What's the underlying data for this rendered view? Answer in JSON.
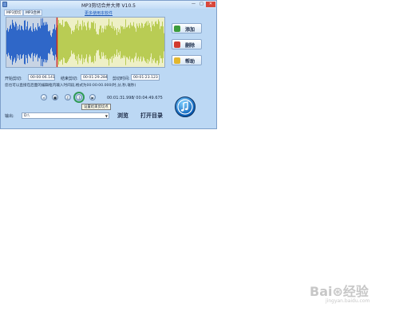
{
  "window": {
    "title": "MP3剪切合并大师 V10.5",
    "minimize": "—",
    "maximize": "□",
    "close": "✕"
  },
  "tabs": [
    {
      "label": "MP3剪切",
      "active": true
    },
    {
      "label": "MP3合并",
      "active": false
    }
  ],
  "promo_link": "更多使用本软件",
  "side_buttons": [
    {
      "label": "添加",
      "icon": "add-icon",
      "color": "#3c9b3a"
    },
    {
      "label": "删除",
      "icon": "delete-icon",
      "color": "#d23b2f"
    },
    {
      "label": "帮助",
      "icon": "help-icon",
      "color": "#e2b62d"
    }
  ],
  "times": {
    "start_label": "开始剪切:",
    "start_value": "00:00:06.141",
    "end_label": "结束剪切:",
    "end_value": "00:01:29.284",
    "length_label": "剪切时间:",
    "length_value": "00:01:23.123"
  },
  "hint": "您也可以直接在后面的编辑框内输入时间段,格式为00:00:00.000(时,分,秒,毫秒)",
  "transport": {
    "buttons": [
      {
        "name": "rewind-button",
        "glyph": "«"
      },
      {
        "name": "stop-button",
        "glyph": "■"
      },
      {
        "name": "set-start-button",
        "glyph": "["
      },
      {
        "name": "set-end-button",
        "glyph": "]"
      },
      {
        "name": "play-button",
        "glyph": "▶"
      }
    ],
    "position": "00:01:31.998",
    "total": "/ 00:04:49.675",
    "tooltip": "设置结束剪切点"
  },
  "output": {
    "label": "输出:",
    "path": "D:\\",
    "browse": "浏览",
    "open_dir": "打开目录"
  },
  "waveform": {
    "selection_start_fraction": 0.32,
    "unselected_color": "#2f67c8",
    "selected_color": "#b9cc54",
    "marker_color": "#d0281e"
  },
  "watermark": {
    "main": "Bai⊛经验",
    "sub": "jingyan.baidu.com"
  }
}
